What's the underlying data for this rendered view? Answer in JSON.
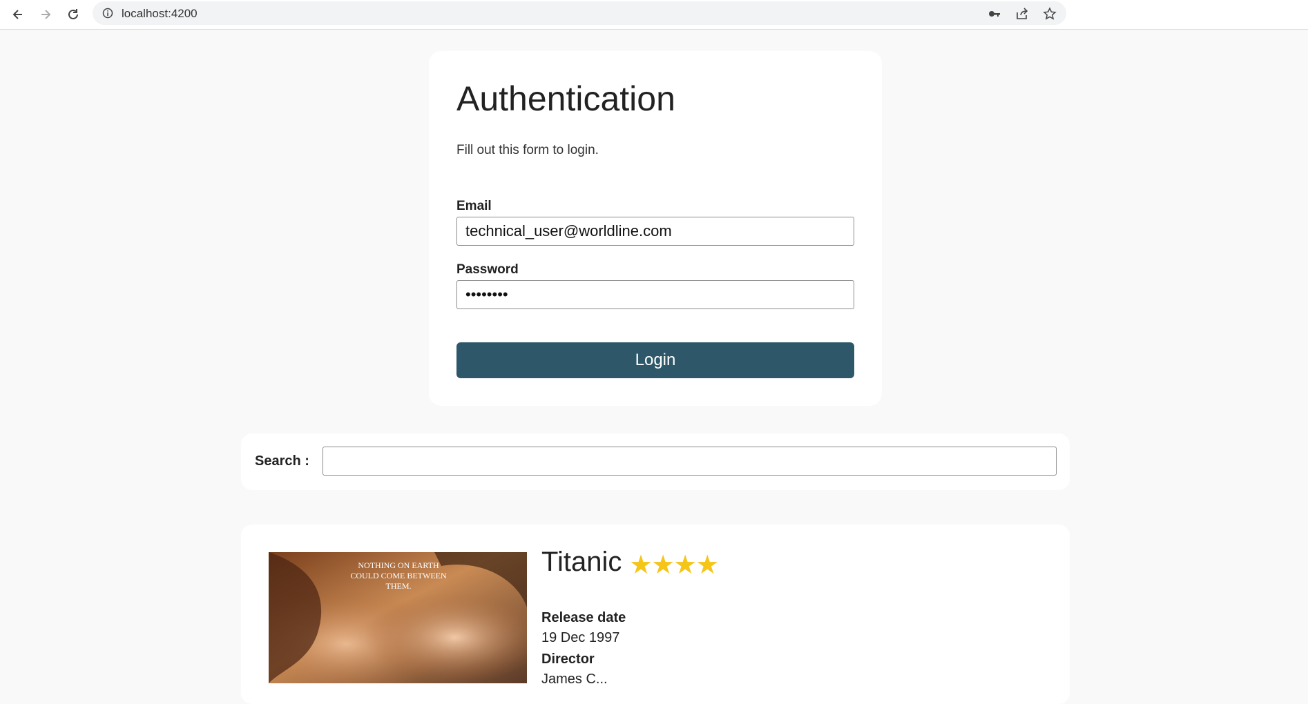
{
  "browser": {
    "url": "localhost:4200"
  },
  "auth": {
    "title": "Authentication",
    "subtitle": "Fill out this form to login.",
    "email_label": "Email",
    "email_value": "technical_user@worldline.com",
    "password_label": "Password",
    "password_value": "password",
    "login_label": "Login"
  },
  "search": {
    "label": "Search :",
    "value": ""
  },
  "movie": {
    "title": "Titanic",
    "rating": "★★★★",
    "poster_tagline": "NOTHING ON EARTH COULD COME BETWEEN THEM.",
    "release_label": "Release date",
    "release_value": "19 Dec 1997",
    "director_label": "Director",
    "director_value": "James C..."
  },
  "colors": {
    "accent": "#2e5869",
    "star": "#f5c518",
    "page_bg": "#f9f9f9"
  }
}
